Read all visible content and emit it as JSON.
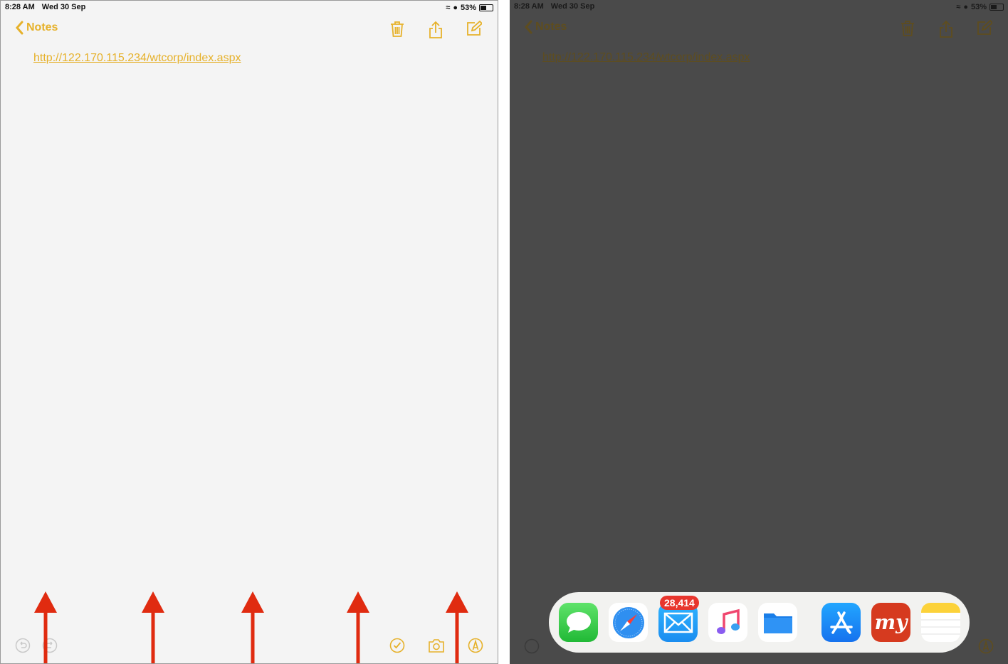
{
  "status_bar": {
    "time": "8:28 AM",
    "date": "Wed 30 Sep",
    "battery": "53%"
  },
  "nav": {
    "back_label": "Notes"
  },
  "note": {
    "link": "http://122.170.115.234/wtcorp/index.aspx"
  },
  "icons": {
    "top": [
      "trash-icon",
      "share-icon",
      "compose-icon"
    ],
    "bottom_left": [
      "undo-icon",
      "redo-icon"
    ],
    "bottom_right": [
      "checklist-icon",
      "camera-icon",
      "markup-icon"
    ]
  },
  "dock": {
    "apps": [
      {
        "name": "Messages",
        "badge": null
      },
      {
        "name": "Safari",
        "badge": null
      },
      {
        "name": "Mail",
        "badge": "28,414"
      },
      {
        "name": "Music",
        "badge": null
      },
      {
        "name": "Files",
        "badge": null
      },
      {
        "name": "App Store",
        "badge": null
      },
      {
        "name": "MakeMyTrip",
        "badge": null
      },
      {
        "name": "Notes",
        "badge": null
      }
    ]
  },
  "colors": {
    "accent": "#e6b12a",
    "arrow": "#e02b10",
    "badge": "#e8362e"
  }
}
